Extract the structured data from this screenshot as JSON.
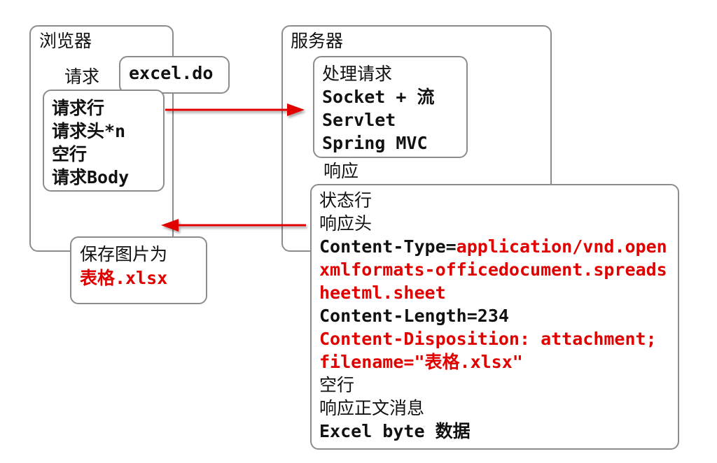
{
  "browser": {
    "title": "浏览器",
    "request_label": "请求",
    "url": "excel.do",
    "request_lines": [
      "请求行",
      "请求头*n",
      "空行",
      "请求Body"
    ],
    "save_line1": "保存图片为",
    "save_filename": "表格.xlsx"
  },
  "server": {
    "title": "服务器",
    "processing": [
      "处理请求",
      "Socket + 流",
      "Servlet",
      "Spring MVC"
    ],
    "response_label": "响应"
  },
  "response": {
    "status_line": "状态行",
    "headers_label": "响应头",
    "content_type_key": "Content-Type=",
    "content_type_val1": "application/vnd.open",
    "content_type_val2": "xmlformats-officedocument.spreads",
    "content_type_val3": "heetml.sheet",
    "content_length": "Content-Length=234",
    "disposition1": "Content-Disposition: attachment;",
    "disposition2": "filename=\"表格.xlsx\"",
    "blank_line": "空行",
    "body_label": "响应正文消息",
    "body_data": "Excel byte 数据"
  },
  "colors": {
    "arrow": "#e00000",
    "highlight": "#e00000",
    "border": "#8c8c8c"
  }
}
